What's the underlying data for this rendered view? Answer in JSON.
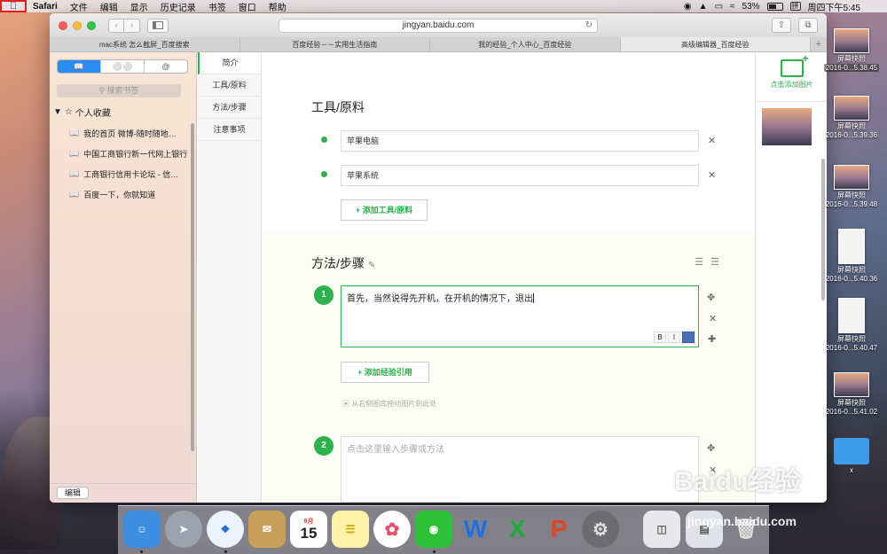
{
  "menubar": {
    "app": "Safari",
    "items": [
      "文件",
      "编辑",
      "显示",
      "历史记录",
      "书签",
      "窗口",
      "帮助"
    ],
    "battery": "53%",
    "input_method": "拼",
    "clock": "周四下午5:45"
  },
  "browser": {
    "url": "jingyan.baidu.com",
    "tabs": [
      {
        "label": "mac系统 怎么截屏_百度搜索"
      },
      {
        "label": "百度经验－－实用生活指南"
      },
      {
        "label": "我的经验_个人中心_百度经验"
      },
      {
        "label": "高级编辑器_百度经验"
      }
    ],
    "tab_add": "+"
  },
  "sidebar": {
    "search_placeholder": "搜索书签",
    "favorites_label": "个人收藏",
    "items": [
      {
        "label": "我的首页 微博-随时随地…"
      },
      {
        "label": "中国工商银行新一代网上银行"
      },
      {
        "label": "工商银行信用卡论坛 - 信…"
      },
      {
        "label": "百度一下，你就知道"
      }
    ],
    "edit_label": "编辑"
  },
  "leftnav": {
    "items": [
      "简介",
      "工具/原料",
      "方法/步骤",
      "注意事项"
    ]
  },
  "editor": {
    "tools_title": "工具/原料",
    "tools": [
      "苹果电脑",
      "苹果系统"
    ],
    "add_tool_label": "+ 添加工具/原料",
    "steps_title": "方法/步骤",
    "steps": [
      {
        "num": "1",
        "text": "首先，当然说得先开机，在开机的情况下，退出"
      },
      {
        "num": "2",
        "placeholder": "点击这里输入步骤或方法"
      }
    ],
    "add_ref_label": "+ 添加经验引用",
    "drag_hint": "从右侧图库拖动图片到此处",
    "format_buttons": [
      "B",
      "I"
    ]
  },
  "rightpane": {
    "add_image_label": "点击添加图片"
  },
  "desktop": {
    "icons": [
      {
        "label": "屏幕快照",
        "sub": "2016-0...5.38.45",
        "selected": true
      },
      {
        "label": "屏幕快照",
        "sub": "2016-0...5.39.36"
      },
      {
        "label": "屏幕快照",
        "sub": "2016-0...5.39.48"
      },
      {
        "label": "屏幕快照",
        "sub": "2016-0...5.40.36"
      },
      {
        "label": "屏幕快照",
        "sub": "2016-0...5.40.47"
      },
      {
        "label": "屏幕快照",
        "sub": "2016-0...5.41.02"
      },
      {
        "label": "x",
        "sub": ""
      }
    ]
  },
  "dock": {
    "calendar_month": "9月",
    "calendar_day": "15"
  },
  "watermark": {
    "brand": "Baidu经验",
    "url": "jingyan.baidu.com"
  }
}
